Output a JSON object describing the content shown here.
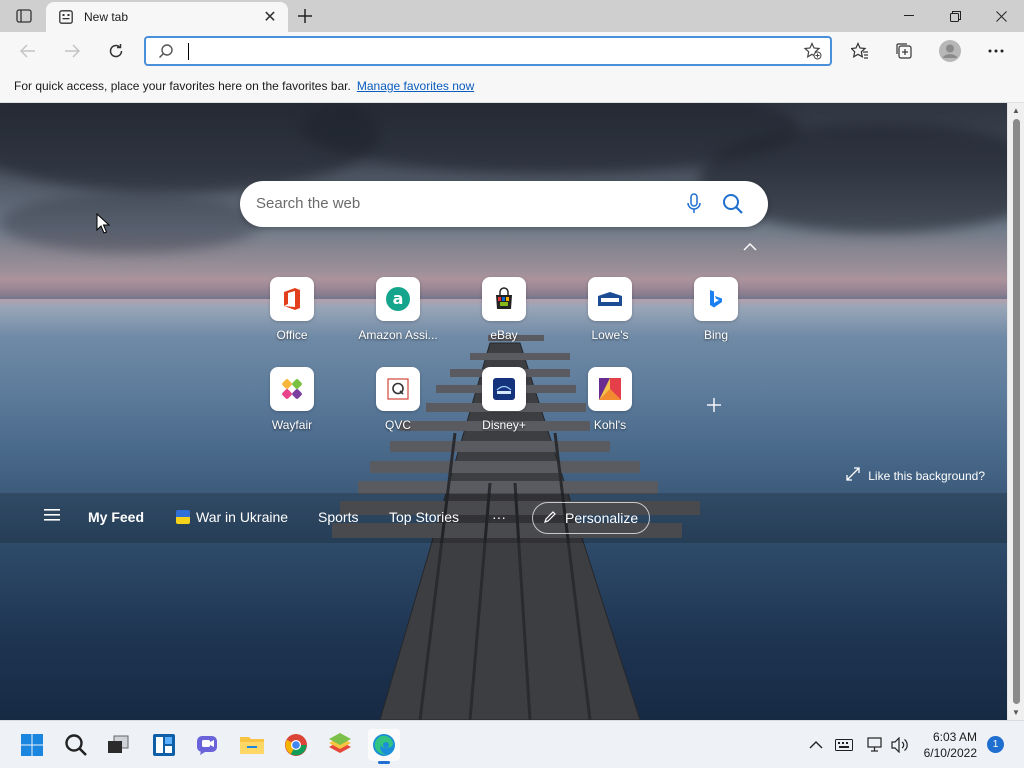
{
  "browser": {
    "tab_title": "New tab",
    "address_value": "",
    "favorites_bar": {
      "text": "For quick access, place your favorites here on the favorites bar.",
      "link": "Manage favorites now"
    }
  },
  "newtab": {
    "search_placeholder": "Search the web",
    "quick_links": [
      {
        "label": "Office",
        "icon": "office-icon"
      },
      {
        "label": "Amazon Assi...",
        "icon": "amazon-icon"
      },
      {
        "label": "eBay",
        "icon": "ebay-icon"
      },
      {
        "label": "Lowe's",
        "icon": "lowes-icon"
      },
      {
        "label": "Bing",
        "icon": "bing-icon"
      },
      {
        "label": "Wayfair",
        "icon": "wayfair-icon"
      },
      {
        "label": "QVC",
        "icon": "qvc-icon"
      },
      {
        "label": "Disney+",
        "icon": "disney-plus-icon"
      },
      {
        "label": "Kohl's",
        "icon": "kohls-icon"
      }
    ],
    "like_background": "Like this background?",
    "feed": {
      "items": [
        "My Feed",
        "War in Ukraine",
        "Sports",
        "Top Stories"
      ],
      "more": "···",
      "personalize": "Personalize"
    }
  },
  "taskbar": {
    "time": "6:03 AM",
    "date": "6/10/2022",
    "notifications": "1"
  },
  "colors": {
    "accent": "#1f6fd1",
    "address_border": "#4a8fd9",
    "link": "#0a5cbf"
  }
}
